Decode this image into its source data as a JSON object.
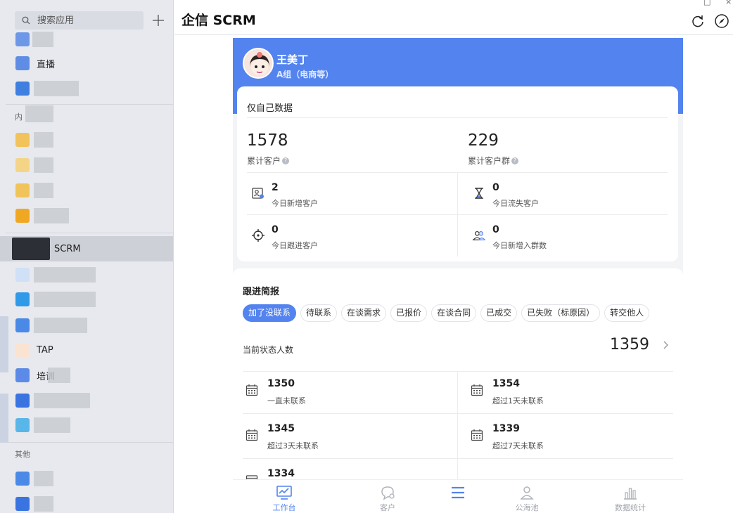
{
  "sidebar": {
    "search_placeholder": "搜索应用",
    "items": [
      {
        "label": "直播"
      },
      {
        "label": "SCRM"
      },
      {
        "label": "TAP"
      },
      {
        "label": "培训"
      }
    ],
    "sections": {
      "internal": "内",
      "other": "其他"
    }
  },
  "header": {
    "title": "企信 SCRM"
  },
  "profile": {
    "name": "王美丁",
    "group": "A组（电商等）"
  },
  "stats": {
    "scope_title": "仅自己数据",
    "total_customers": {
      "value": "1578",
      "label": "累计客户"
    },
    "total_groups": {
      "value": "229",
      "label": "累计客户群"
    },
    "metrics": [
      {
        "value": "2",
        "label": "今日新增客户",
        "icon": "new-customer-icon"
      },
      {
        "value": "0",
        "label": "今日流失客户",
        "icon": "hourglass-icon"
      },
      {
        "value": "0",
        "label": "今日跟进客户",
        "icon": "target-icon"
      },
      {
        "value": "0",
        "label": "今日新增入群数",
        "icon": "group-icon"
      }
    ]
  },
  "followup": {
    "title": "跟进简报",
    "chips": [
      "加了没联系",
      "待联系",
      "在谈需求",
      "已报价",
      "在谈合同",
      "已成交",
      "已失败（标原因）",
      "转交他人"
    ],
    "active_chip": "加了没联系",
    "current_label": "当前状态人数",
    "current_value": "1359",
    "items": [
      {
        "value": "1350",
        "label": "一直未联系"
      },
      {
        "value": "1354",
        "label": "超过1天未联系"
      },
      {
        "value": "1345",
        "label": "超过3天未联系"
      },
      {
        "value": "1339",
        "label": "超过7天未联系"
      },
      {
        "value": "1334",
        "label": ""
      }
    ]
  },
  "tabs": [
    {
      "label": "工作台",
      "icon": "dashboard-icon"
    },
    {
      "label": "客户",
      "icon": "chat-icon"
    },
    {
      "label": "",
      "icon": "menu-icon"
    },
    {
      "label": "公海池",
      "icon": "user-pool-icon"
    },
    {
      "label": "数据统计",
      "icon": "bar-chart-icon"
    }
  ],
  "colors": {
    "accent": "#5383ee",
    "sidebar_bg": "#e7e9ee"
  }
}
